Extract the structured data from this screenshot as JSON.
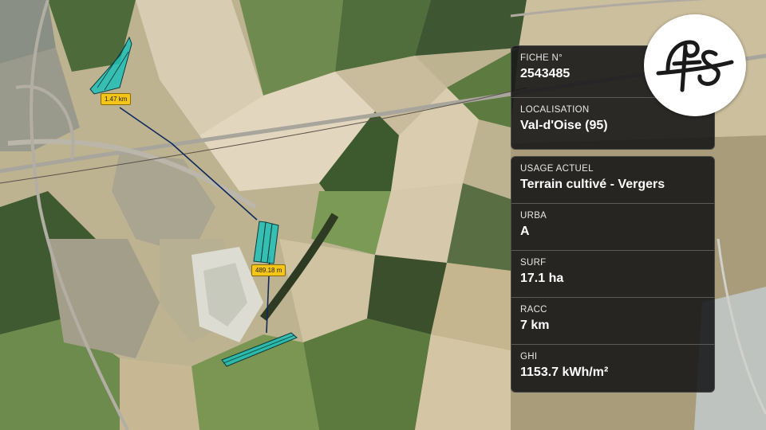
{
  "map": {
    "distance_labels": [
      "1.47 km",
      "489.18 m"
    ]
  },
  "card_top": {
    "rows": [
      {
        "label": "FICHE N°",
        "value": "2543485"
      },
      {
        "label": "LOCALISATION",
        "value": "Val-d'Oise (95)"
      }
    ]
  },
  "card_bottom": {
    "rows": [
      {
        "label": "USAGE ACTUEL",
        "value": "Terrain cultivé - Vergers"
      },
      {
        "label": "URBA",
        "value": "A"
      },
      {
        "label": "SURF",
        "value": "17.1 ha"
      },
      {
        "label": "RACC",
        "value": "7 km"
      },
      {
        "label": "GHI",
        "value": "1153.7 kWh/m²"
      }
    ]
  },
  "logo": {
    "icon": "fs-monogram-logo"
  },
  "colors": {
    "parcel": "#1fbfb8",
    "connection_line": "#0f2a5a",
    "label_bg": "#f5c518"
  }
}
